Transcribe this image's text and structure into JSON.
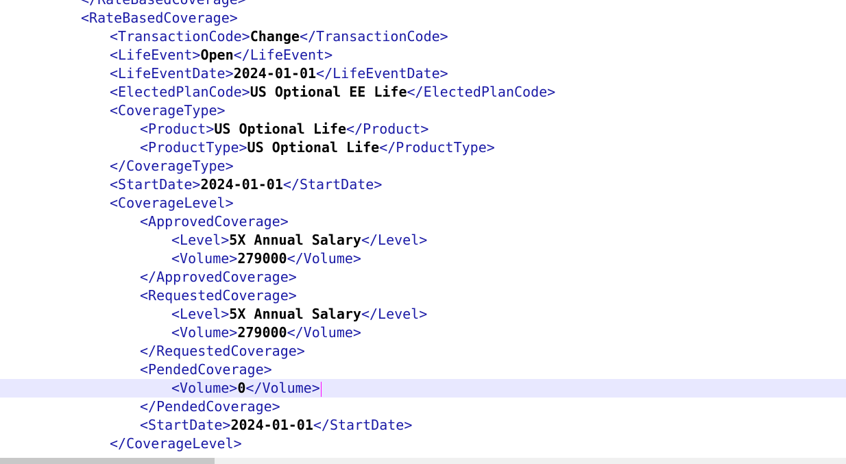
{
  "lines": [
    {
      "indent": 3,
      "open": "</RateBasedCoverage>",
      "value": "",
      "close": ""
    },
    {
      "indent": 3,
      "open": "<RateBasedCoverage>",
      "value": "",
      "close": ""
    },
    {
      "indent": 4,
      "open": "<TransactionCode>",
      "value": "Change",
      "close": "</TransactionCode>"
    },
    {
      "indent": 4,
      "open": "<LifeEvent>",
      "value": "Open",
      "close": "</LifeEvent>"
    },
    {
      "indent": 4,
      "open": "<LifeEventDate>",
      "value": "2024-01-01",
      "close": "</LifeEventDate>"
    },
    {
      "indent": 4,
      "open": "<ElectedPlanCode>",
      "value": "US Optional EE Life",
      "close": "</ElectedPlanCode>"
    },
    {
      "indent": 4,
      "open": "<CoverageType>",
      "value": "",
      "close": ""
    },
    {
      "indent": 5,
      "open": "<Product>",
      "value": "US Optional Life",
      "close": "</Product>"
    },
    {
      "indent": 5,
      "open": "<ProductType>",
      "value": "US Optional Life",
      "close": "</ProductType>"
    },
    {
      "indent": 4,
      "open": "</CoverageType>",
      "value": "",
      "close": ""
    },
    {
      "indent": 4,
      "open": "<StartDate>",
      "value": "2024-01-01",
      "close": "</StartDate>"
    },
    {
      "indent": 4,
      "open": "<CoverageLevel>",
      "value": "",
      "close": ""
    },
    {
      "indent": 5,
      "open": "<ApprovedCoverage>",
      "value": "",
      "close": ""
    },
    {
      "indent": 6,
      "open": "<Level>",
      "value": "5X Annual Salary",
      "close": "</Level>"
    },
    {
      "indent": 6,
      "open": "<Volume>",
      "value": "279000",
      "close": "</Volume>"
    },
    {
      "indent": 5,
      "open": "</ApprovedCoverage>",
      "value": "",
      "close": ""
    },
    {
      "indent": 5,
      "open": "<RequestedCoverage>",
      "value": "",
      "close": ""
    },
    {
      "indent": 6,
      "open": "<Level>",
      "value": "5X Annual Salary",
      "close": "</Level>"
    },
    {
      "indent": 6,
      "open": "<Volume>",
      "value": "279000",
      "close": "</Volume>"
    },
    {
      "indent": 5,
      "open": "</RequestedCoverage>",
      "value": "",
      "close": ""
    },
    {
      "indent": 5,
      "open": "<PendedCoverage>",
      "value": "",
      "close": ""
    },
    {
      "indent": 6,
      "open": "<Volume>",
      "value": "0",
      "close": "</Volume>",
      "current": true
    },
    {
      "indent": 5,
      "open": "</PendedCoverage>",
      "value": "",
      "close": ""
    },
    {
      "indent": 5,
      "open": "<StartDate>",
      "value": "2024-01-01",
      "close": "</StartDate>"
    },
    {
      "indent": 4,
      "open": "</CoverageLevel>",
      "value": "",
      "close": ""
    }
  ],
  "colors": {
    "tag": "#1a1aa6",
    "value": "#000000",
    "current_line": "#e8e8ff",
    "caret": "#ff00ff"
  }
}
